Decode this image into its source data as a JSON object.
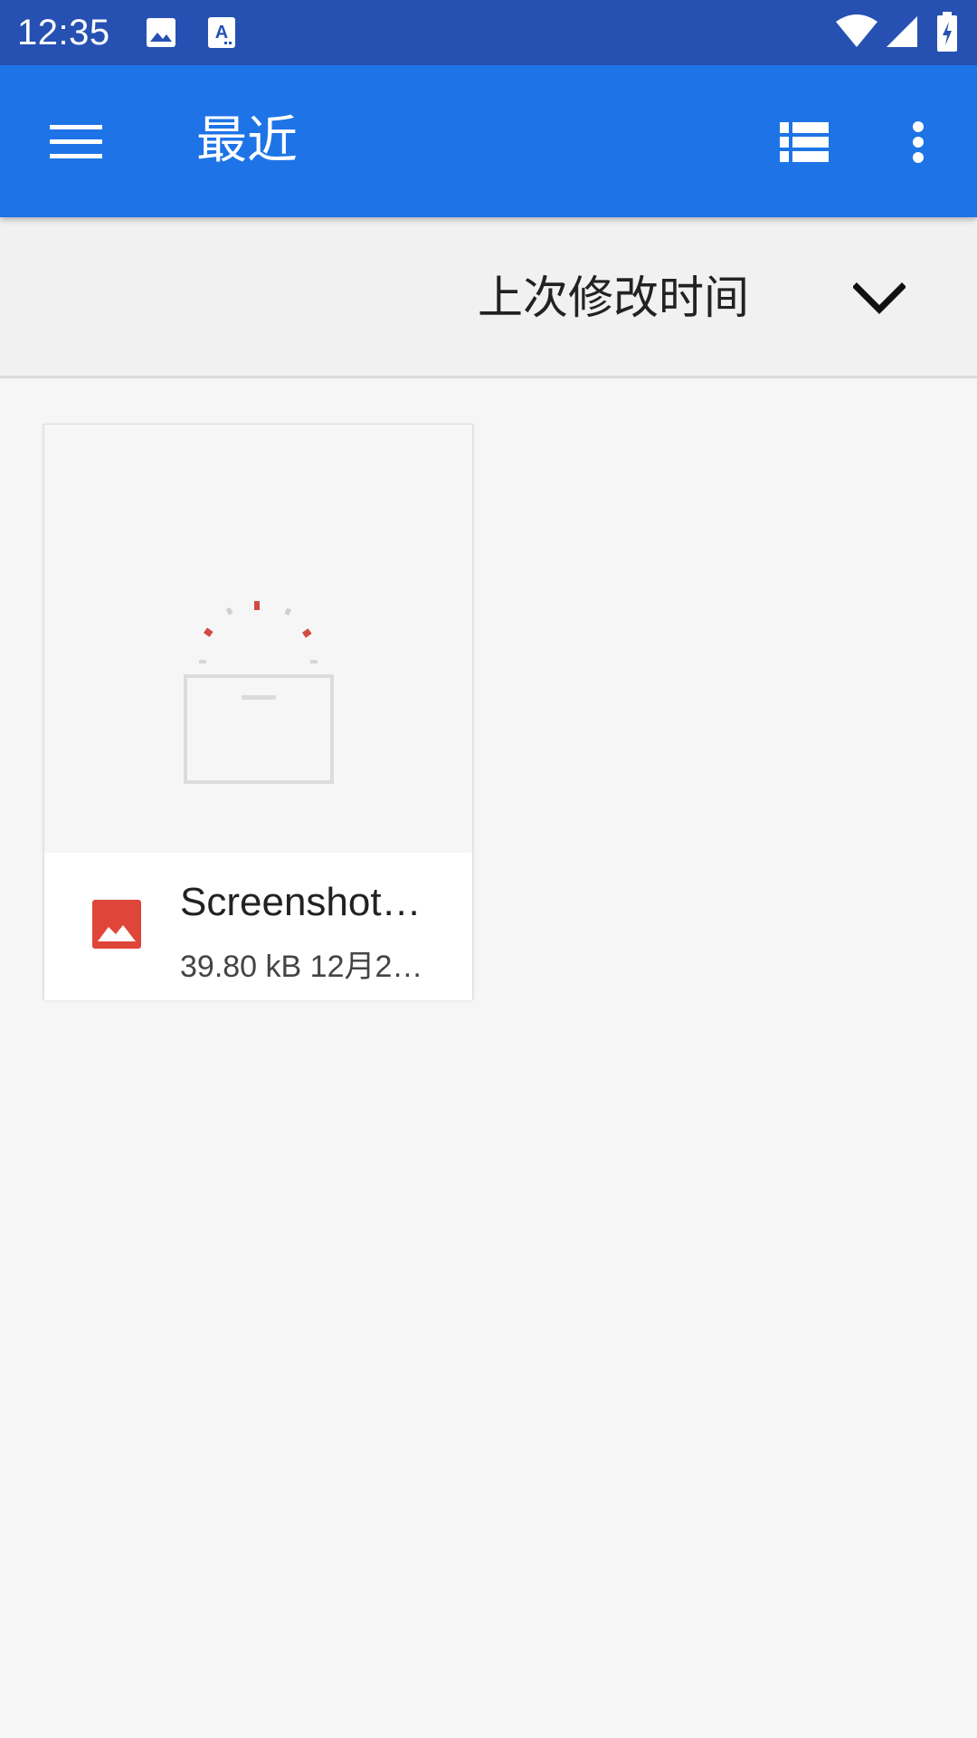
{
  "status_bar": {
    "time": "12:35",
    "left_icons": [
      "image-notification-icon",
      "text-notification-icon"
    ],
    "right_icons": [
      "wifi-icon",
      "cell-signal-icon",
      "battery-charging-icon"
    ]
  },
  "app_bar": {
    "title": "最近",
    "menu_icon": "hamburger-menu-icon",
    "view_toggle_icon": "list-view-icon",
    "overflow_icon": "more-vert-icon",
    "background": "#1e74e6"
  },
  "sort": {
    "label": "上次修改时间",
    "dropdown_icon": "chevron-down-icon"
  },
  "files": [
    {
      "name": "Screenshot…",
      "meta": "39.80 kB 12月2…",
      "type_icon": "image-file-icon",
      "type_color": "#e0453a",
      "thumbnail": "loading-placeholder"
    }
  ],
  "colors": {
    "status_bar": "#2651b2",
    "accent_red": "#d94a3d"
  }
}
